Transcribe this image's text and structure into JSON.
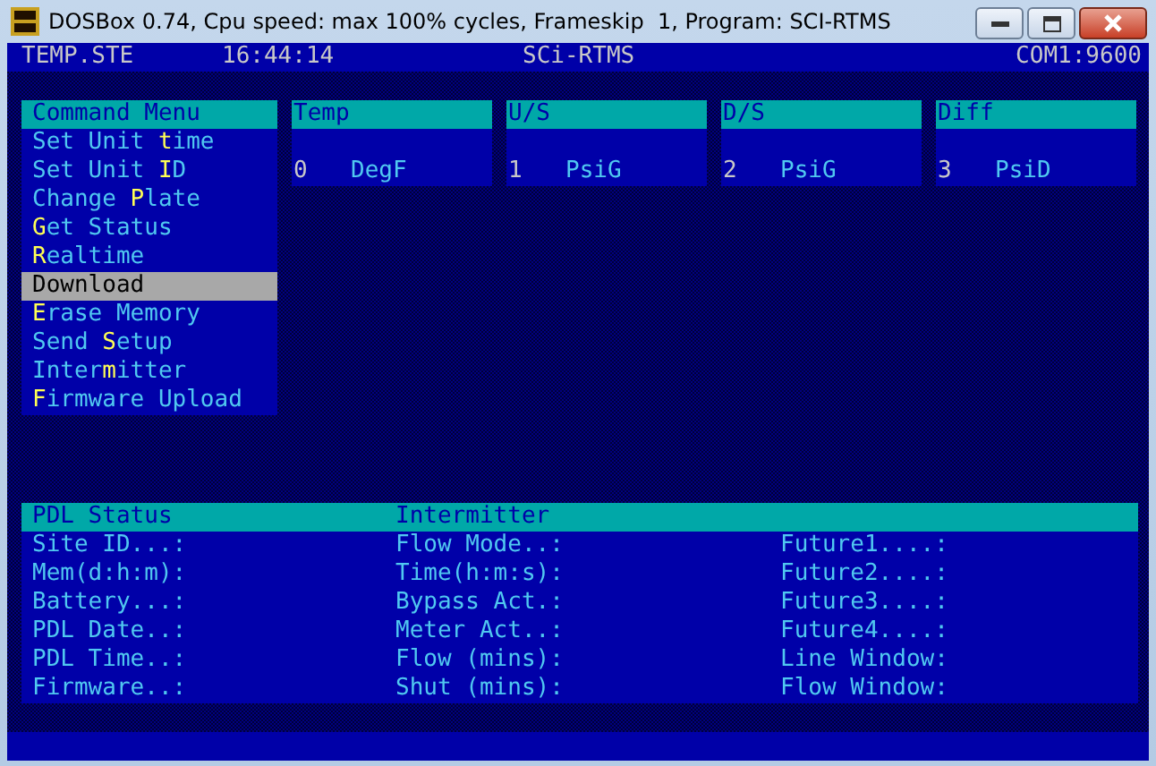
{
  "window": {
    "title": "DOSBox 0.74, Cpu speed: max 100% cycles, Frameskip  1, Program: SCI-RTMS"
  },
  "header": {
    "file": "TEMP.STE",
    "time": "16:44:14",
    "program": "SCi-RTMS",
    "port": "COM1:9600"
  },
  "command_menu": {
    "title": "Command Menu",
    "items": [
      {
        "label": "Set Unit **t**ime",
        "selected": false
      },
      {
        "label": "Set Unit **I**D",
        "selected": false
      },
      {
        "label": "Change **P**late",
        "selected": false
      },
      {
        "label": "**G**et Status",
        "selected": false
      },
      {
        "label": "**R**ealtime",
        "selected": false
      },
      {
        "label": "Download",
        "selected": true
      },
      {
        "label": "**E**rase Memory",
        "selected": false
      },
      {
        "label": "Send **S**etup",
        "selected": false
      },
      {
        "label": "Inter**m**itter",
        "selected": false
      },
      {
        "label": "**F**irmware Upload",
        "selected": false
      }
    ]
  },
  "channels": [
    {
      "title": "Temp",
      "number": "0",
      "unit": "DegF"
    },
    {
      "title": "U/S",
      "number": "1",
      "unit": "PsiG"
    },
    {
      "title": "D/S",
      "number": "2",
      "unit": "PsiG"
    },
    {
      "title": "Diff",
      "number": "3",
      "unit": "PsiD"
    }
  ],
  "pdl_status": {
    "title": "PDL Status",
    "subtitle": "Intermitter",
    "columns": [
      [
        "Site ID...:",
        "Mem(d:h:m):",
        "Battery...:",
        "PDL Date..:",
        "PDL Time..:",
        "Firmware..:"
      ],
      [
        "Flow Mode..:",
        "Time(h:m:s):",
        "Bypass Act.:",
        "Meter Act..:",
        "Flow (mins):",
        "Shut (mins):"
      ],
      [
        "Future1....:",
        "Future2....:",
        "Future3....:",
        "Future4....:",
        "Line Window:",
        "Flow Window:"
      ]
    ]
  }
}
